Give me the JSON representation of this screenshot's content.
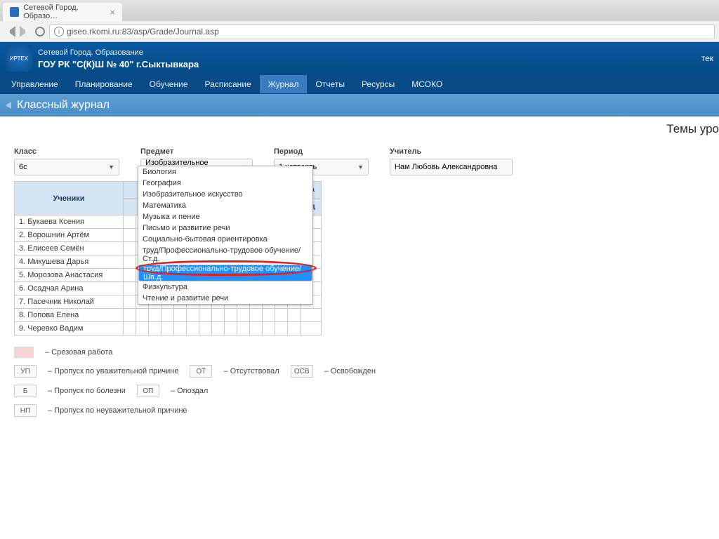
{
  "browser": {
    "tab_title": "Сетевой Город. Образо…",
    "url": "giseo.rkomi.ru:83/asp/Grade/Journal.asp"
  },
  "header": {
    "product": "Сетевой Город. Образование",
    "school": "ГОУ РК \"С(К)Ш № 40\" г.Сыктывкара",
    "logo_label": "ИРТЕХ",
    "right": "тек"
  },
  "nav": {
    "items": [
      "Управление",
      "Планирование",
      "Обучение",
      "Расписание",
      "Журнал",
      "Отчеты",
      "Ресурсы",
      "МСОКО"
    ],
    "active_index": 4
  },
  "page_title": "Классный журнал",
  "section_title_right": "Темы уро",
  "filters": {
    "class_label": "Класс",
    "class_value": "6с",
    "subject_label": "Предмет",
    "subject_value": "Изобразительное искусство",
    "period_label": "Период",
    "period_value": "1 четверть",
    "teacher_label": "Учитель",
    "teacher_value": "Нам Любовь Александровна"
  },
  "subject_dropdown": {
    "options": [
      "Биология",
      "География",
      "Изобразительное искусство",
      "Математика",
      "Музыка и пение",
      "Письмо и развитие речи",
      "Социально-бытовая ориентировка",
      "труд/Профессионально-трудовое обучение/Ст.д.",
      "труд/Профессионально-трудовое обучение/Шв.д.",
      "Физкультура",
      "Чтение и развитие речи"
    ],
    "highlighted_index": 8
  },
  "table": {
    "students_header": "Ученики",
    "right_stub_top": "ка",
    "right_stub_bottom": "од",
    "students": [
      "1. Букаева Ксения",
      "2. Ворошнин Артём",
      "3. Елисеев Семён",
      "4. Микушева Дарья",
      "5. Морозова Анастасия",
      "6. Осадчая Арина",
      "7. Пасечник Николай",
      "8. Попова Елена",
      "9. Черевко Вадим"
    ]
  },
  "legend": {
    "srez": "– Срезовая работа",
    "codes": [
      {
        "code": "УП",
        "text": "– Пропуск по уважительной причине"
      },
      {
        "code": "ОТ",
        "text": "– Отсутствовал"
      },
      {
        "code": "ОСВ",
        "text": "– Освобожден"
      },
      {
        "code": "Б",
        "text": "– Пропуск по болезни"
      },
      {
        "code": "ОП",
        "text": "– Опоздал"
      },
      {
        "code": "НП",
        "text": "– Пропуск по неуважительной причине"
      }
    ]
  }
}
